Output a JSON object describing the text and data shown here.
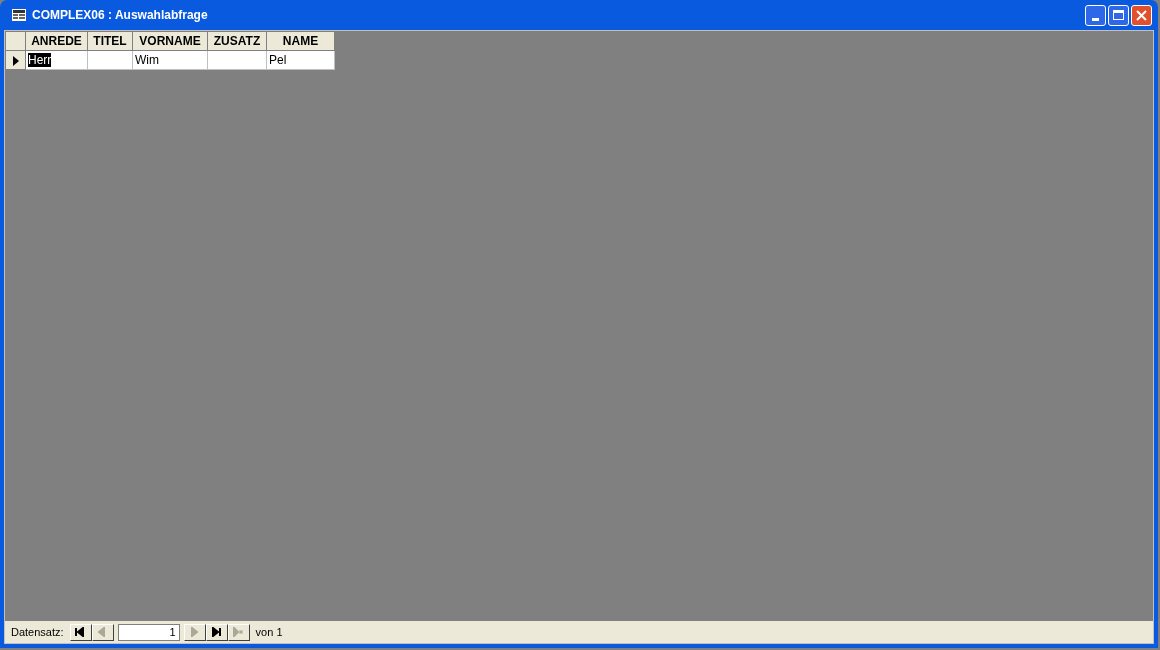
{
  "window": {
    "title": "COMPLEX06 : Auswahlabfrage"
  },
  "table": {
    "columns": [
      "ANREDE",
      "TITEL",
      "VORNAME",
      "ZUSATZ",
      "NAME"
    ],
    "rows": [
      {
        "current": true,
        "cells": [
          {
            "text": "Herr",
            "selected": true
          },
          {
            "selected": false
          },
          {
            "text": "Wim",
            "selected": false
          },
          {
            "selected": false
          },
          {
            "text": "Pel",
            "selected": false
          }
        ]
      }
    ]
  },
  "navigation": {
    "label": "Datensatz:",
    "record": "1",
    "total": "von 1",
    "buttons_before": [
      {
        "kind": "first",
        "disabled": false
      },
      {
        "kind": "prev",
        "disabled": true
      }
    ],
    "buttons_after": [
      {
        "kind": "next",
        "disabled": true
      },
      {
        "kind": "last",
        "disabled": false
      },
      {
        "kind": "new",
        "disabled": true
      }
    ]
  }
}
